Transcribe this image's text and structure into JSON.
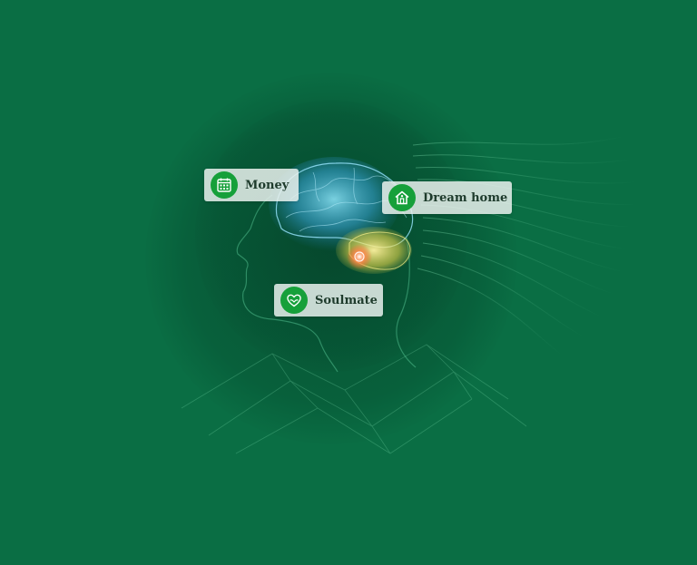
{
  "labels": {
    "money": {
      "text": "Money",
      "icon": "calendar-icon"
    },
    "dream_home": {
      "text": "Dream home",
      "icon": "house-icon"
    },
    "soulmate": {
      "text": "Soulmate",
      "icon": "heart-icon"
    }
  },
  "colors": {
    "background": "#0a6e44",
    "badge": "#16a03a",
    "label_bg": "#e8f0ec",
    "label_text": "#1e3b2c",
    "brain_blue": "#4fc3f7",
    "brain_yellow": "#ffe066",
    "hotspot": "#ff6a3d"
  }
}
